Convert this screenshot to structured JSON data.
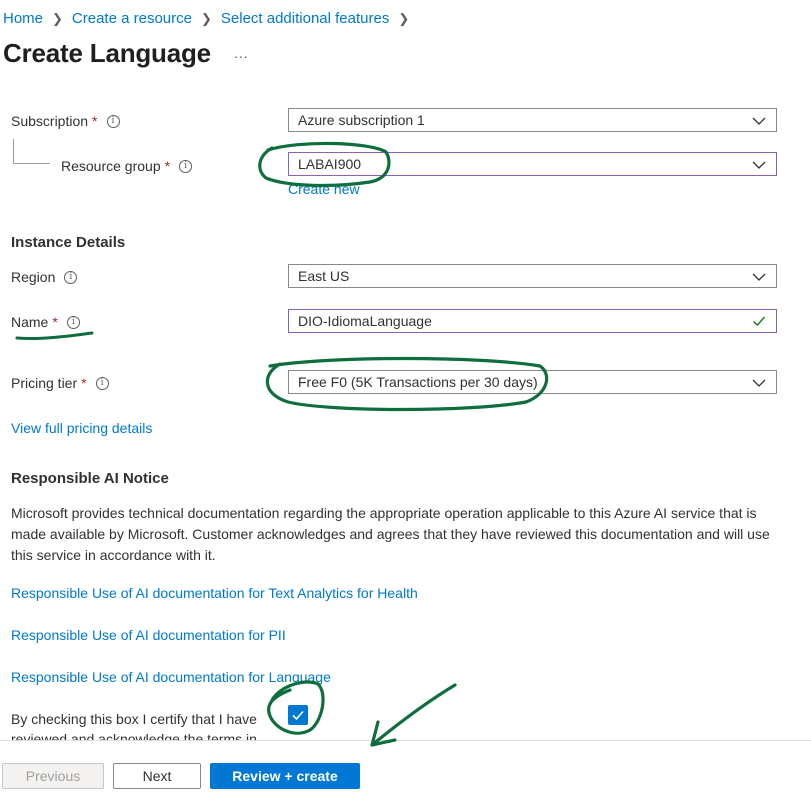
{
  "breadcrumb": [
    "Home",
    "Create a resource",
    "Select additional features"
  ],
  "page_title": "Create Language",
  "more_label": "...",
  "subscription": {
    "label": "Subscription",
    "value": "Azure subscription 1"
  },
  "resource_group": {
    "label": "Resource group",
    "value": "LABAI900",
    "create_new": "Create new"
  },
  "instance_details": {
    "title": "Instance Details"
  },
  "region": {
    "label": "Region",
    "value": "East US"
  },
  "name": {
    "label": "Name",
    "value": "DIO-IdiomaLanguage"
  },
  "pricing_tier": {
    "label": "Pricing tier",
    "value": "Free F0 (5K Transactions per 30 days)"
  },
  "pricing_link": "View full pricing details",
  "responsible_ai": {
    "title": "Responsible AI Notice",
    "notice": "Microsoft provides technical documentation regarding the appropriate operation applicable to this Azure AI service that is made available by Microsoft. Customer acknowledges and agrees that they have reviewed this documentation and will use this service in accordance with it.",
    "links": [
      "Responsible Use of AI documentation for Text Analytics for Health",
      "Responsible Use of AI documentation for PII",
      "Responsible Use of AI documentation for Language"
    ],
    "certify_line1": "By checking this box I certify that I have",
    "certify_line2": "reviewed and acknowledge the terms in",
    "checked": true
  },
  "required_mark": "*",
  "info_glyph": "i",
  "footer": {
    "previous": "Previous",
    "next": "Next",
    "review_create": "Review + create"
  },
  "colors": {
    "accent": "#0078d4",
    "required": "#a4262c",
    "valid": "#107c10",
    "annotation": "#0e6e3e",
    "focus_border": "#8764b8"
  }
}
